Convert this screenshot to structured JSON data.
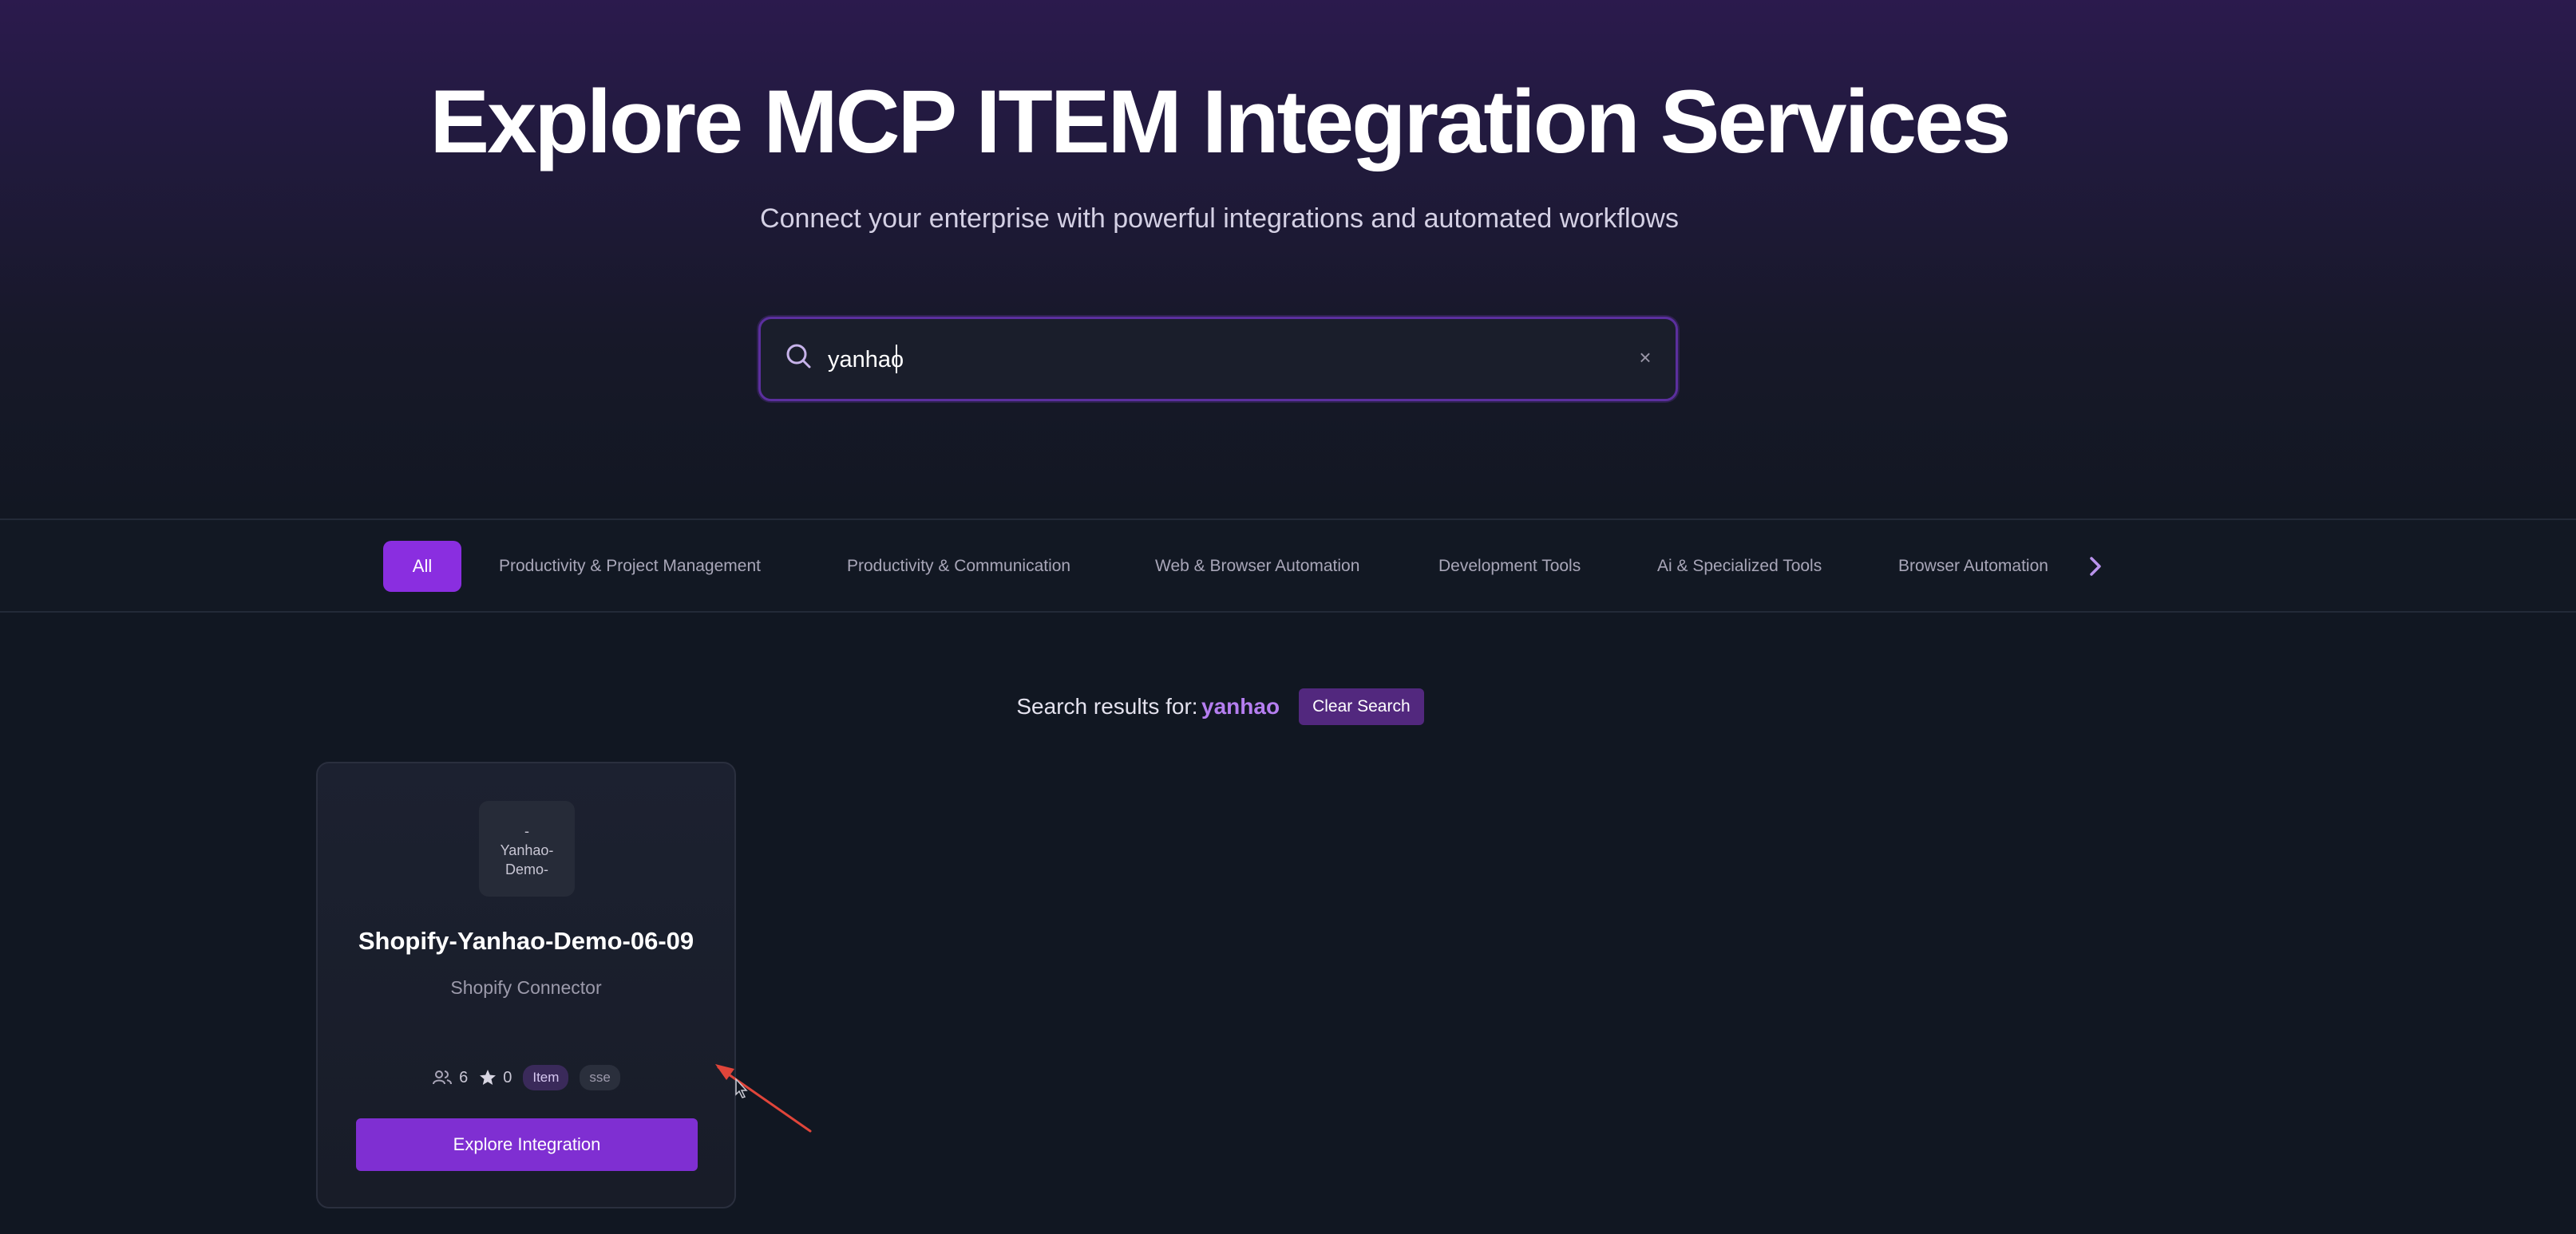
{
  "hero": {
    "title": "Explore MCP ITEM Integration Services",
    "subtitle": "Connect your enterprise with powerful integrations and automated workflows"
  },
  "search": {
    "value": "yanhao",
    "clear_symbol": "×",
    "icon": "search-icon"
  },
  "categories": {
    "active": "All",
    "items": [
      "Productivity & Project Management",
      "Productivity & Communication",
      "Web & Browser Automation",
      "Development Tools",
      "Ai & Specialized Tools",
      "Browser Automation"
    ],
    "next_icon": "chevron-right-icon"
  },
  "results": {
    "label": "Search results for:",
    "term": "yanhao",
    "clear_label": "Clear Search"
  },
  "cards": [
    {
      "logo_lines": [
        "-",
        "Yanhao-",
        "Demo-"
      ],
      "title": "Shopify-Yanhao-Demo-06-09",
      "subtitle": "Shopify Connector",
      "users": "6",
      "stars": "0",
      "tag_type": "Item",
      "tag_transport": "sse",
      "button_label": "Explore Integration"
    }
  ],
  "colors": {
    "accent": "#8a2ee0",
    "button": "#7f2fd2",
    "highlight": "#b57ef0",
    "background": "#111722",
    "annotation": "#e0453a"
  }
}
